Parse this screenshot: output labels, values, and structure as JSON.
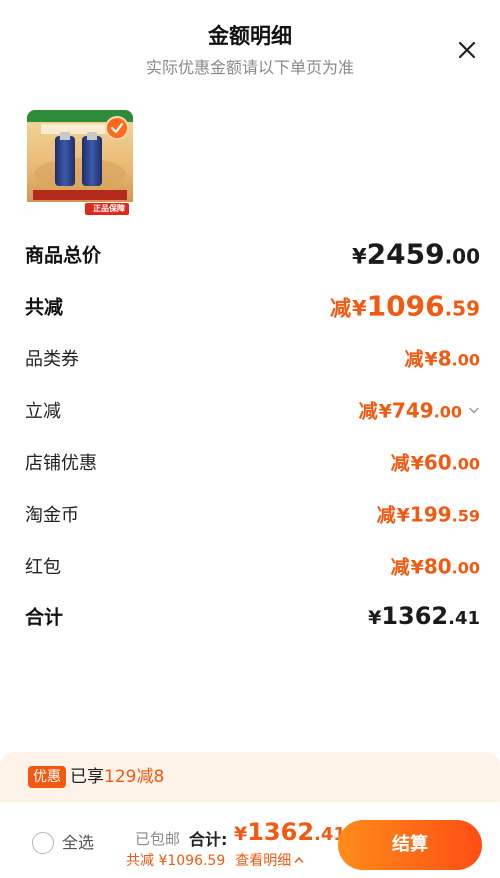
{
  "header": {
    "title": "金额明细",
    "subtitle": "实际优惠金额请以下单页为准"
  },
  "product": {
    "image_text": "正品保障"
  },
  "rows": [
    {
      "label": "商品总价",
      "prefix": "",
      "yen": "¥",
      "int": "2459",
      "dec": ".00"
    },
    {
      "label": "共减",
      "prefix": "减",
      "yen": "¥",
      "int": "1096",
      "dec": ".59"
    },
    {
      "label": "品类券",
      "prefix": "减",
      "yen": "¥",
      "int": "8",
      "dec": ".00"
    },
    {
      "label": "立减",
      "prefix": "减",
      "yen": "¥",
      "int": "749",
      "dec": ".00"
    },
    {
      "label": "店铺优惠",
      "prefix": "减",
      "yen": "¥",
      "int": "60",
      "dec": ".00"
    },
    {
      "label": "淘金币",
      "prefix": "减",
      "yen": "¥",
      "int": "199",
      "dec": ".59"
    },
    {
      "label": "红包",
      "prefix": "减",
      "yen": "¥",
      "int": "80",
      "dec": ".00"
    },
    {
      "label": "合计",
      "prefix": "",
      "yen": "¥",
      "int": "1362",
      "dec": ".41"
    }
  ],
  "promo": {
    "badge": "优惠",
    "text_prefix": "已享",
    "text_highlight": "129减8"
  },
  "footer": {
    "select_all": "全选",
    "shipping": "已包邮",
    "total_label": "合计:",
    "total_yen": "¥",
    "total_int": "1362",
    "total_dec": ".41",
    "reduce_text": "共减 ¥1096.59",
    "details_link": "查看明细",
    "checkout_label": "结算"
  },
  "colors": {
    "accent": "#f25a12",
    "promo_bg": "#fdf3e8"
  }
}
